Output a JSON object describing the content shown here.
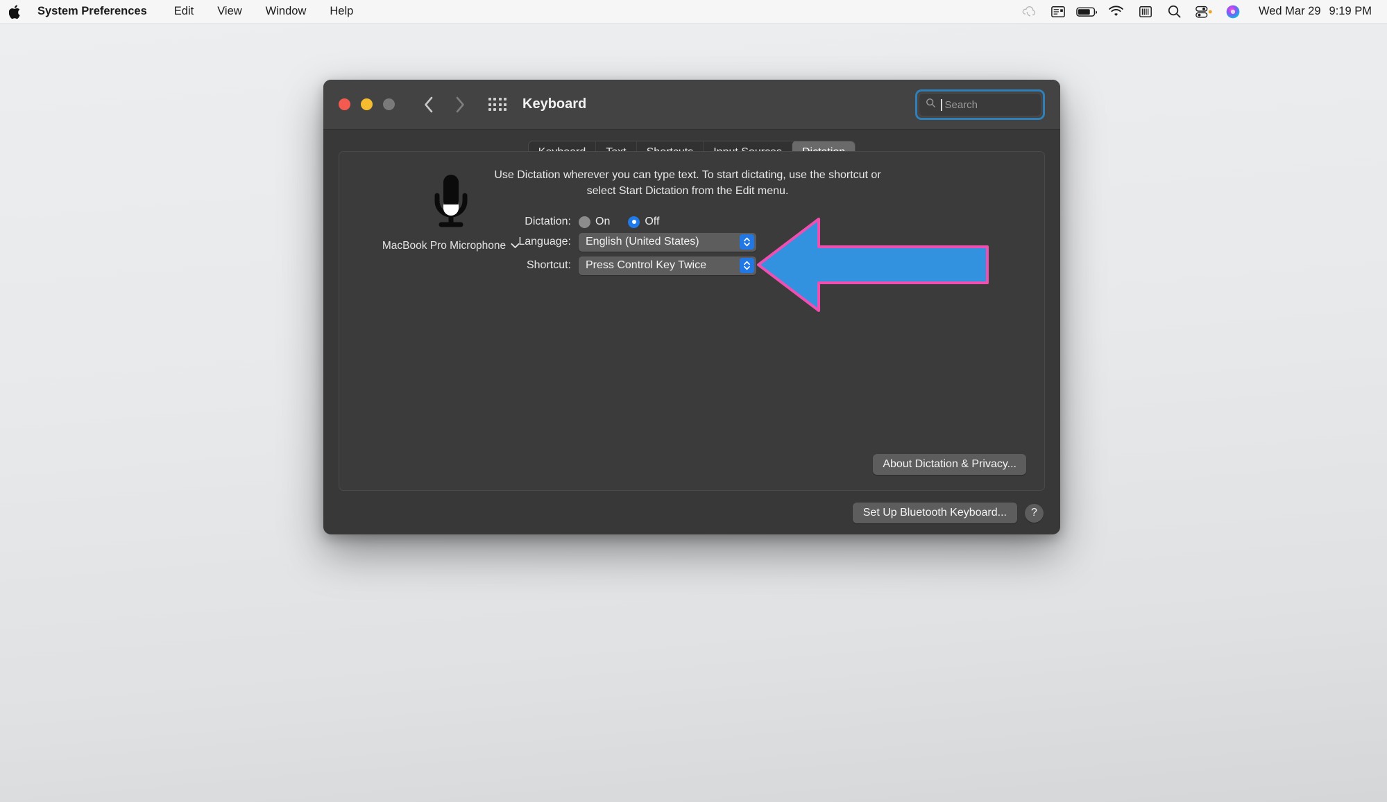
{
  "menubar": {
    "apple_icon": "apple-logo-icon",
    "items": [
      {
        "label": "System Preferences",
        "bold": true
      },
      {
        "label": "Edit",
        "bold": false
      },
      {
        "label": "View",
        "bold": false
      },
      {
        "label": "Window",
        "bold": false
      },
      {
        "label": "Help",
        "bold": false
      }
    ],
    "status_icons": [
      "creative-cloud-icon",
      "news-widget-icon",
      "battery-icon",
      "wifi-icon",
      "equalizer-icon",
      "spotlight-search-icon",
      "control-center-icon",
      "siri-icon"
    ],
    "date": "Wed Mar 29",
    "time": "9:19 PM"
  },
  "window": {
    "title": "Keyboard",
    "traffic_lights": [
      "close-button",
      "minimize-button",
      "zoom-button"
    ],
    "nav": {
      "back_icon": "chevron-left-icon",
      "forward_icon": "chevron-right-icon",
      "grid_icon": "show-all-grid-icon"
    },
    "search": {
      "placeholder": "Search",
      "value": "",
      "icon": "search-icon",
      "focused": true
    },
    "tabs": [
      {
        "label": "Keyboard",
        "selected": false
      },
      {
        "label": "Text",
        "selected": false
      },
      {
        "label": "Shortcuts",
        "selected": false
      },
      {
        "label": "Input Sources",
        "selected": false
      },
      {
        "label": "Dictation",
        "selected": true
      }
    ],
    "bottom": {
      "bluetooth_label": "Set Up Bluetooth Keyboard...",
      "help_label": "?"
    }
  },
  "dictation": {
    "mic_icon": "microphone-icon",
    "mic_source_label": "MacBook Pro Microphone",
    "mic_source_chevron": "chevron-down-icon",
    "description": "Use Dictation wherever you can type text. To start dictating, use the shortcut or select Start Dictation from the Edit menu.",
    "dictation_label": "Dictation:",
    "radio_on_label": "On",
    "radio_off_label": "Off",
    "radio_selected": "Off",
    "language_label": "Language:",
    "language_value": "English (United States)",
    "shortcut_label": "Shortcut:",
    "shortcut_value": "Press Control Key Twice",
    "about_label": "About Dictation & Privacy..."
  },
  "annotation": {
    "arrow_name": "callout-arrow-pointing-to-shortcut-popup",
    "direction": "left",
    "fill_color": "#3292e0",
    "outline_color": "#ef4fb0"
  },
  "colors": {
    "window_bg": "#383838",
    "toolbar_bg": "#434343",
    "panel_bg": "#3b3b3b",
    "accent_blue": "#1f7aeb",
    "focus_ring": "#2f7fb8",
    "desktop_top": "#eceef0",
    "desktop_bottom": "#d4d6d8"
  }
}
